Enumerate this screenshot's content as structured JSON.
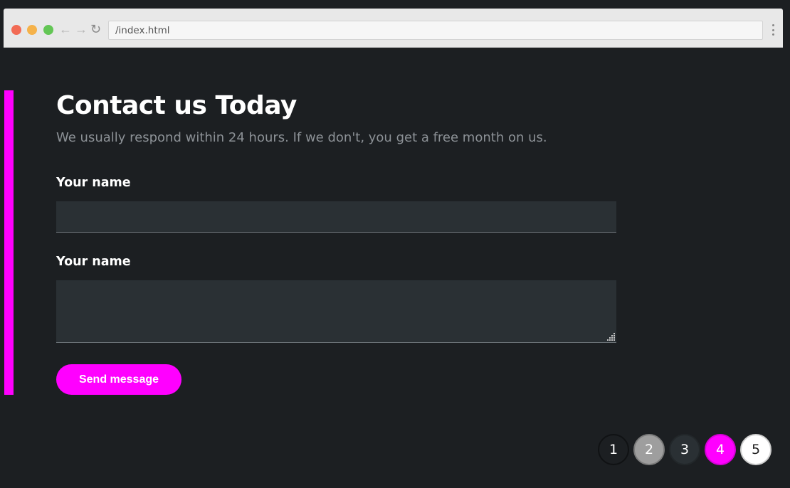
{
  "browser": {
    "url": "/index.html",
    "back_icon": "←",
    "forward_icon": "→",
    "reload_icon": "↻"
  },
  "contact": {
    "title": "Contact us Today",
    "subtitle": "We usually respond within 24 hours. If we don't, you get a free month on us.",
    "field_name_label": "Your name",
    "field_name_value": "",
    "field_message_label": "Your name",
    "field_message_value": "",
    "submit_label": "Send message"
  },
  "pagination": {
    "pages": [
      "1",
      "2",
      "3",
      "4",
      "5"
    ]
  },
  "colors": {
    "background": "#1c1f22",
    "accent": "#ff00ff",
    "input_bg": "#2a3034",
    "subtitle": "#8c9196"
  },
  "icons": [
    "back-arrow-icon",
    "forward-arrow-icon",
    "reload-icon",
    "kebab-menu-icon",
    "resize-handle-icon"
  ]
}
